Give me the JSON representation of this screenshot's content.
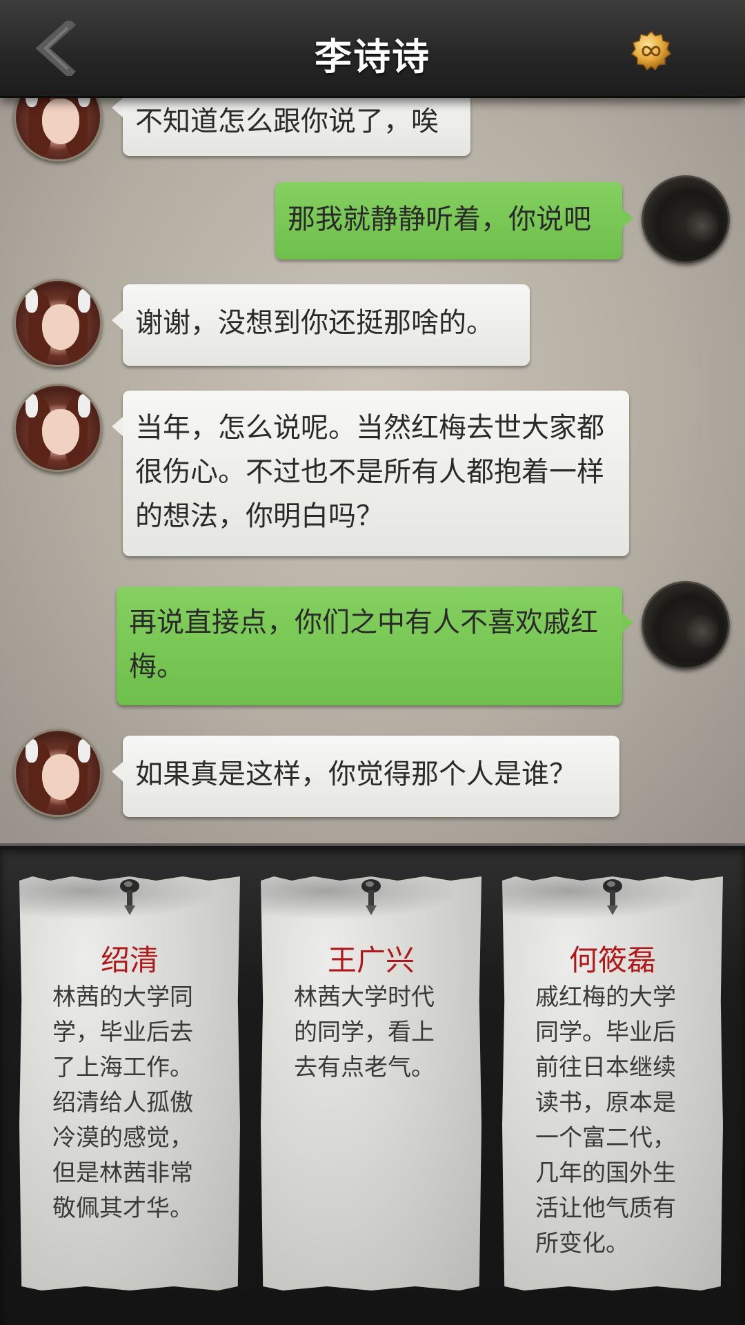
{
  "header": {
    "title": "李诗诗",
    "back_icon": "chevron-left-icon",
    "coin_icon": "infinity-coin-icon",
    "colors": {
      "title": "#ffffff",
      "bar": "#2b2b2b"
    }
  },
  "chat": {
    "messages": [
      {
        "from": "her",
        "text": "不知道怎么跟你说了，唉"
      },
      {
        "from": "me",
        "text": "那我就静静听着，你说吧"
      },
      {
        "from": "her",
        "text": "谢谢，没想到你还挺那啥的。"
      },
      {
        "from": "her",
        "text": "当年，怎么说呢。当然红梅去世大家都很伤心。不过也不是所有人都抱着一样的想法，你明白吗？"
      },
      {
        "from": "me",
        "text": "再说直接点，你们之中有人不喜欢戚红梅。"
      },
      {
        "from": "her",
        "text": "如果真是这样，你觉得那个人是谁？"
      }
    ],
    "colors": {
      "outgoing": "#7cc958",
      "incoming": "#f0f0ee"
    }
  },
  "suspects": [
    {
      "name": "绍清",
      "desc": "林茜的大学同学，毕业后去了上海工作。绍清给人孤傲冷漠的感觉，但是林茜非常敬佩其才华。"
    },
    {
      "name": "王广兴",
      "desc": "林茜大学时代的同学，看上去有点老气。"
    },
    {
      "name": "何筱磊",
      "desc": "戚红梅的大学同学。毕业后前往日本继续读书，原本是一个富二代，几年的国外生活让他气质有所变化。"
    }
  ],
  "colors": {
    "suspect_name": "#b0181a"
  }
}
